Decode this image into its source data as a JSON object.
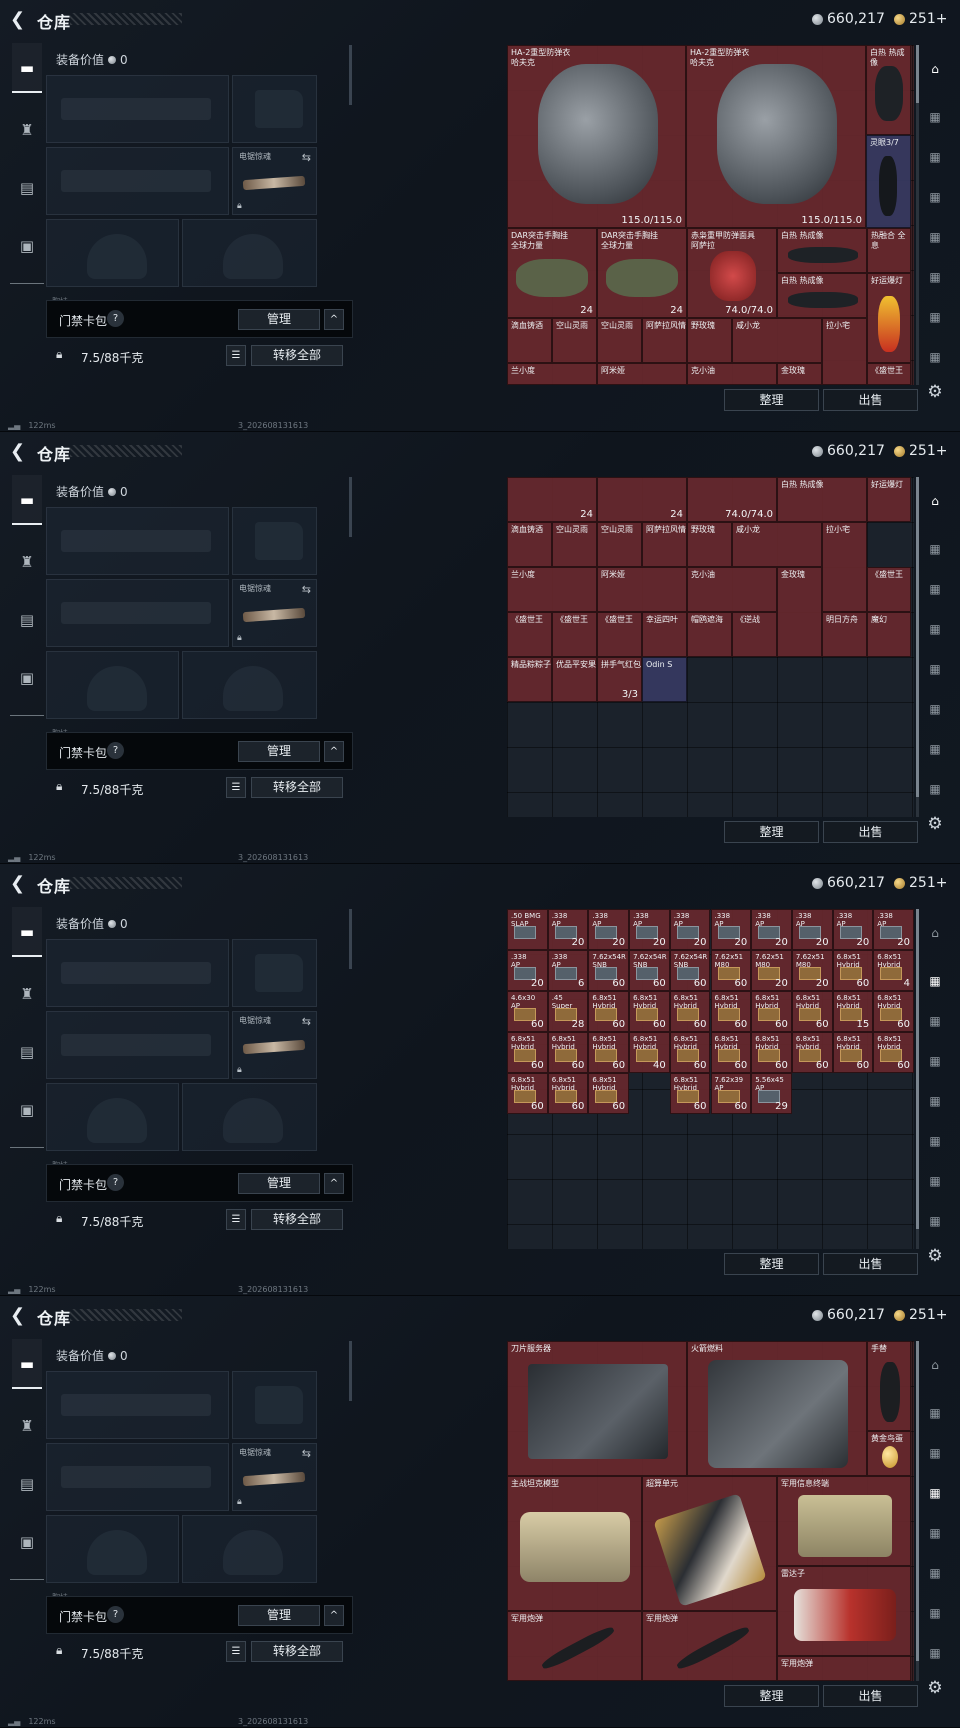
{
  "header": {
    "title": "仓库",
    "silver": "660,217",
    "gold": "251+"
  },
  "equipment": {
    "value_label": "装备价值",
    "value": "0",
    "melee_label": "电锯惊魂",
    "slim_label": "胸挂"
  },
  "backpack": {
    "name": "门禁卡包",
    "help": "?",
    "manage": "管理",
    "collapse": "^"
  },
  "weight": {
    "value": "7.5/88千克",
    "transfer_all": "转移全部"
  },
  "status": {
    "ping": "122ms",
    "build": "3_202608131613"
  },
  "stash_actions": {
    "tidy": "整理",
    "sell": "出售"
  },
  "icons": [
    "back-arrow-icon",
    "rifle-icon",
    "helmet-icon",
    "vest-icon",
    "briefcase-icon",
    "silver-coin-icon",
    "gold-coin-icon",
    "lock-icon",
    "swap-icon",
    "list-icon",
    "help-icon",
    "chevron-up-icon",
    "gear-icon",
    "stash-tab-icon"
  ],
  "screens": [
    {
      "items": [
        {
          "name": "HA-2重型防弹衣\n哈夫克",
          "count": "115.0/115.0"
        },
        {
          "name": "HA-2重型防弹衣\n哈夫克",
          "count": "115.0/115.0"
        },
        {
          "name": "白热 热成像",
          "count": ""
        },
        {
          "name": "灵眼3/7",
          "count": ""
        },
        {
          "name": "DAR突击手胸挂\n全球力量",
          "count": "24"
        },
        {
          "name": "DAR突击手胸挂\n全球力量",
          "count": "24"
        },
        {
          "name": "赤枭重甲防弹面具\n阿萨拉",
          "count": "74.0/74.0"
        },
        {
          "name": "白热 热成像",
          "count": ""
        },
        {
          "name": "热融合 全息",
          "count": ""
        },
        {
          "name": "白热 热成像",
          "count": ""
        },
        {
          "name": "好运爆灯",
          "count": ""
        },
        {
          "name": "滴血铸酒",
          "count": ""
        },
        {
          "name": "空山灵雨",
          "count": ""
        },
        {
          "name": "空山灵雨",
          "count": ""
        },
        {
          "name": "阿萨拉风情",
          "count": ""
        },
        {
          "name": "野玫瑰",
          "count": ""
        },
        {
          "name": "咸小龙",
          "count": ""
        },
        {
          "name": "拉小宅",
          "count": ""
        },
        {
          "name": "兰小度",
          "count": ""
        },
        {
          "name": "阿米娅",
          "count": ""
        },
        {
          "name": "克小油",
          "count": ""
        },
        {
          "name": "金玫瑰",
          "count": ""
        },
        {
          "name": "《盛世王",
          "count": ""
        }
      ]
    },
    {
      "items": [
        {
          "name": "",
          "count": "24"
        },
        {
          "name": "",
          "count": "24"
        },
        {
          "name": "",
          "count": "74.0/74.0"
        },
        {
          "name": "白热 热成像",
          "count": ""
        },
        {
          "name": "好运爆灯",
          "count": ""
        },
        {
          "name": "滴血铸酒",
          "count": ""
        },
        {
          "name": "空山灵雨",
          "count": ""
        },
        {
          "name": "空山灵雨",
          "count": ""
        },
        {
          "name": "阿萨拉风情",
          "count": ""
        },
        {
          "name": "野玫瑰",
          "count": ""
        },
        {
          "name": "咸小龙",
          "count": ""
        },
        {
          "name": "拉小宅",
          "count": ""
        },
        {
          "name": "兰小度",
          "count": ""
        },
        {
          "name": "阿米娅",
          "count": ""
        },
        {
          "name": "克小油",
          "count": ""
        },
        {
          "name": "金玫瑰",
          "count": ""
        },
        {
          "name": "《盛世王",
          "count": ""
        },
        {
          "name": "《盛世王",
          "count": ""
        },
        {
          "name": "《盛世王",
          "count": ""
        },
        {
          "name": "《盛世王",
          "count": ""
        },
        {
          "name": "幸运四叶",
          "count": ""
        },
        {
          "name": "帽鸥遮海",
          "count": ""
        },
        {
          "name": "《逆战",
          "count": ""
        },
        {
          "name": "明日方舟",
          "count": ""
        },
        {
          "name": "魔幻",
          "count": ""
        },
        {
          "name": "精品粽粽子",
          "count": ""
        },
        {
          "name": "优品平安果",
          "count": ""
        },
        {
          "name": "拼手气红包",
          "count": "3/3"
        },
        {
          "name": "Odin S",
          "count": ""
        }
      ]
    },
    {
      "items": [
        {
          "name": ".50 BMG\nSLAP",
          "count": ""
        },
        {
          "name": ".338\nAP",
          "count": "20"
        },
        {
          "name": ".338\nAP",
          "count": "20"
        },
        {
          "name": ".338\nAP",
          "count": "20"
        },
        {
          "name": ".338\nAP",
          "count": "20"
        },
        {
          "name": ".338\nAP",
          "count": "20"
        },
        {
          "name": ".338\nAP",
          "count": "20"
        },
        {
          "name": ".338\nAP",
          "count": "20"
        },
        {
          "name": ".338\nAP",
          "count": "20"
        },
        {
          "name": ".338\nAP",
          "count": "20"
        },
        {
          "name": ".338\nAP",
          "count": "20"
        },
        {
          "name": ".338\nAP",
          "count": "6"
        },
        {
          "name": "7.62x54R\nSNB",
          "count": "60"
        },
        {
          "name": "7.62x54R\nSNB",
          "count": "60"
        },
        {
          "name": "7.62x54R\nSNB",
          "count": "60"
        },
        {
          "name": "7.62x51\nM80",
          "count": "60"
        },
        {
          "name": "7.62x51\nM80",
          "count": "20"
        },
        {
          "name": "7.62x51\nM80",
          "count": "20"
        },
        {
          "name": "6.8x51\nHybrid",
          "count": "60"
        },
        {
          "name": "6.8x51\nHybrid",
          "count": "4"
        },
        {
          "name": "4.6x30\nAP",
          "count": "60"
        },
        {
          "name": ".45\nSuper",
          "count": "28"
        },
        {
          "name": "6.8x51\nHybrid",
          "count": "60"
        },
        {
          "name": "6.8x51\nHybrid",
          "count": "60"
        },
        {
          "name": "6.8x51\nHybrid",
          "count": "60"
        },
        {
          "name": "6.8x51\nHybrid",
          "count": "60"
        },
        {
          "name": "6.8x51\nHybrid",
          "count": "60"
        },
        {
          "name": "6.8x51\nHybrid",
          "count": "60"
        },
        {
          "name": "6.8x51\nHybrid",
          "count": "15"
        },
        {
          "name": "6.8x51\nHybrid",
          "count": "60"
        },
        {
          "name": "6.8x51\nHybrid",
          "count": "60"
        },
        {
          "name": "6.8x51\nHybrid",
          "count": "60"
        },
        {
          "name": "6.8x51\nHybrid",
          "count": "60"
        },
        {
          "name": "6.8x51\nHybrid",
          "count": "40"
        },
        {
          "name": "6.8x51\nHybrid",
          "count": "60"
        },
        {
          "name": "6.8x51\nHybrid",
          "count": "60"
        },
        {
          "name": "6.8x51\nHybrid",
          "count": "60"
        },
        {
          "name": "6.8x51\nHybrid",
          "count": "60"
        },
        {
          "name": "6.8x51\nHybrid",
          "count": "60"
        },
        {
          "name": "6.8x51\nHybrid",
          "count": "60"
        },
        {
          "name": "6.8x51\nHybrid",
          "count": "60"
        },
        {
          "name": "6.8x51\nHybrid",
          "count": "60"
        },
        {
          "name": "6.8x51\nHybrid",
          "count": "60"
        },
        {
          "name": "6.8x51\nHybrid",
          "count": "60"
        },
        {
          "name": "7.62x39\nAP",
          "count": "60"
        },
        {
          "name": "5.56x45\nAP",
          "count": "29"
        }
      ]
    },
    {
      "items": [
        {
          "name": "刀片服务器",
          "count": ""
        },
        {
          "name": "火箭燃料",
          "count": ""
        },
        {
          "name": "手替",
          "count": ""
        },
        {
          "name": "黄金鸟蛋",
          "count": ""
        },
        {
          "name": "主战坦克模型",
          "count": ""
        },
        {
          "name": "超算单元",
          "count": ""
        },
        {
          "name": "军用信息终端",
          "count": ""
        },
        {
          "name": "雷达子",
          "count": ""
        },
        {
          "name": "军用炮弹",
          "count": ""
        },
        {
          "name": "军用炮弹",
          "count": ""
        },
        {
          "name": "军用炮弹",
          "count": ""
        }
      ]
    }
  ]
}
